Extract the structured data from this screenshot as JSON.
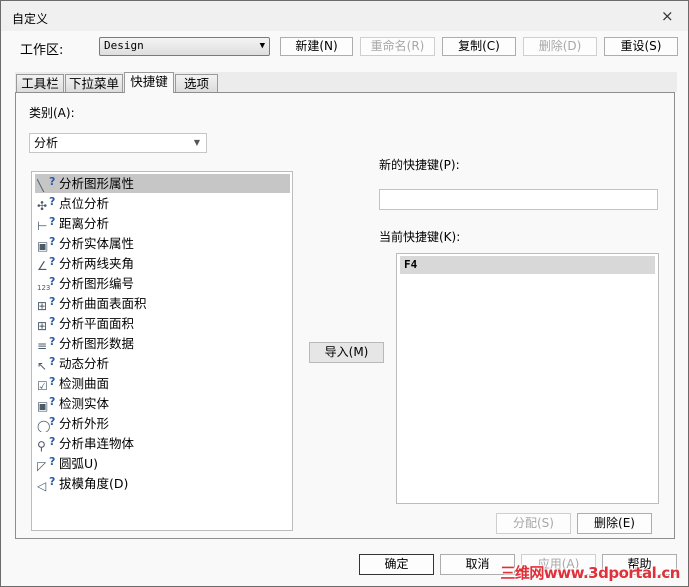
{
  "window": {
    "title": "自定义",
    "close_label": "×"
  },
  "workspace": {
    "label": "工作区:",
    "value": "Design",
    "buttons": [
      {
        "label": "新建(N)",
        "enabled": true
      },
      {
        "label": "重命名(R)",
        "enabled": false
      },
      {
        "label": "复制(C)",
        "enabled": true
      },
      {
        "label": "删除(D)",
        "enabled": false
      },
      {
        "label": "重设(S)",
        "enabled": true
      }
    ]
  },
  "tabs": [
    {
      "label": "工具栏"
    },
    {
      "label": "下拉菜单"
    },
    {
      "label": "快捷键",
      "active": true
    },
    {
      "label": "选项"
    }
  ],
  "category": {
    "label": "类别(A):",
    "value": "分析"
  },
  "commands": [
    {
      "label": "分析图形属性",
      "icon": "line-query-icon",
      "selected": true
    },
    {
      "label": "点位分析",
      "icon": "point-query-icon"
    },
    {
      "label": "距离分析",
      "icon": "distance-query-icon"
    },
    {
      "label": "分析实体属性",
      "icon": "solid-query-icon"
    },
    {
      "label": "分析两线夹角",
      "icon": "angle-query-icon"
    },
    {
      "label": "分析图形编号",
      "icon": "number-query-icon"
    },
    {
      "label": "分析曲面表面积",
      "icon": "surface-area-query-icon"
    },
    {
      "label": "分析平面面积",
      "icon": "plane-area-query-icon"
    },
    {
      "label": "分析图形数据",
      "icon": "data-query-icon"
    },
    {
      "label": "动态分析",
      "icon": "dynamic-query-icon"
    },
    {
      "label": "检测曲面",
      "icon": "check-surface-icon"
    },
    {
      "label": "检测实体",
      "icon": "check-solid-icon"
    },
    {
      "label": "分析外形",
      "icon": "contour-query-icon"
    },
    {
      "label": "分析串连物体",
      "icon": "chain-query-icon"
    },
    {
      "label": "圆弧U)",
      "icon": "arc-query-icon"
    },
    {
      "label": "拔模角度(D)",
      "icon": "draft-angle-icon"
    }
  ],
  "import_label": "导入(M)",
  "new_shortcut": {
    "label": "新的快捷键(P):",
    "value": ""
  },
  "current_shortcut": {
    "label": "当前快捷键(K):",
    "items": [
      "F4"
    ]
  },
  "assign_label": "分配(S)",
  "remove_label": "删除(E)",
  "footer": {
    "ok": "确定",
    "cancel": "取消",
    "apply": "应用(A)",
    "help": "帮助"
  },
  "watermark": "三维网www.3dportal.cn"
}
